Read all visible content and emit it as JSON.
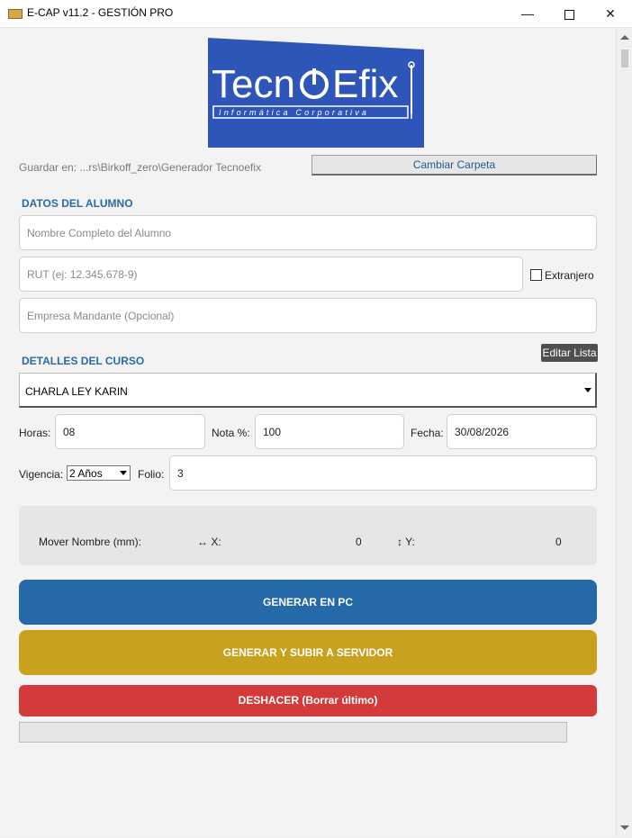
{
  "window": {
    "title": "E-CAP v11.2 - GESTIÓN PRO",
    "minimize": "—",
    "close": "✕"
  },
  "logo": {
    "brand_left": "Tecn",
    "brand_right": "Efix",
    "tagline": "Informática  Corporativa",
    "bg_color": "#2d56b8"
  },
  "storage": {
    "label": "Guardar en: ...rs\\Birkoff_zero\\Generador Tecnoefix",
    "change_button": "Cambiar Carpeta"
  },
  "student": {
    "section_title": "DATOS DEL ALUMNO",
    "name_placeholder": "Nombre Completo del Alumno",
    "rut_placeholder": "RUT (ej: 12.345.678-9)",
    "foreign_label": "Extranjero",
    "company_placeholder": "Empresa Mandante (Opcional)"
  },
  "course": {
    "section_title": "DETALLES DEL CURSO",
    "edit_list_button": "Editar Lista",
    "selected_course": "CHARLA LEY KARIN",
    "hours_label": "Horas:",
    "hours_value": "08",
    "grade_label": "Nota %:",
    "grade_value": "100",
    "date_label": "Fecha:",
    "date_value": "30/08/2026",
    "validity_label": "Vigencia:",
    "validity_value": "2 Años",
    "folio_label": "Folio:",
    "folio_value": "3"
  },
  "mover": {
    "label": "Mover Nombre (mm):",
    "x_label": "↔ X:",
    "x_value": "0",
    "y_label": "↕ Y:",
    "y_value": "0"
  },
  "actions": {
    "generate_pc": "GENERAR EN PC",
    "generate_upload": "GENERAR Y SUBIR A SERVIDOR",
    "undo": "DESHACER (Borrar último)"
  },
  "colors": {
    "section_title": "#2b6aa3",
    "btn_pc": "#2569a8",
    "btn_servidor": "#c8a11f",
    "btn_deshacer": "#d33a3a"
  }
}
